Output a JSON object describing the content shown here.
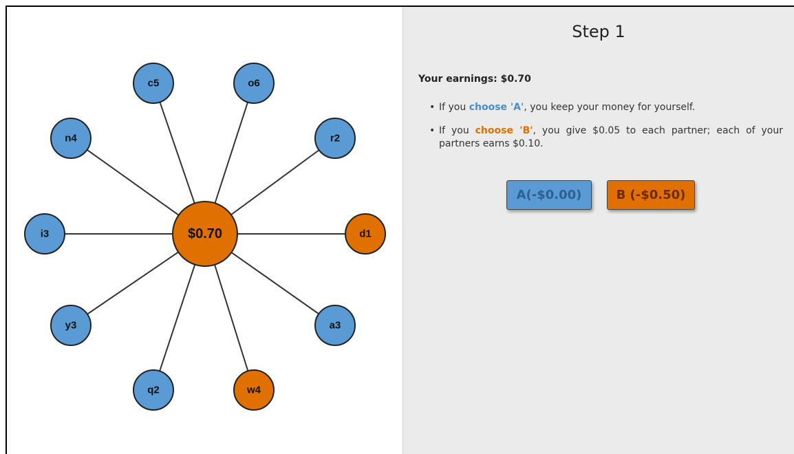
{
  "center": {
    "label": "$0.70",
    "color": "#e07000"
  },
  "neighbors": [
    {
      "label": "c5",
      "color": "#5b9bd5"
    },
    {
      "label": "o6",
      "color": "#5b9bd5"
    },
    {
      "label": "r2",
      "color": "#5b9bd5"
    },
    {
      "label": "d1",
      "color": "#e07000"
    },
    {
      "label": "a3",
      "color": "#5b9bd5"
    },
    {
      "label": "w4",
      "color": "#e07000"
    },
    {
      "label": "q2",
      "color": "#5b9bd5"
    },
    {
      "label": "y3",
      "color": "#5b9bd5"
    },
    {
      "label": "i3",
      "color": "#5b9bd5"
    },
    {
      "label": "n4",
      "color": "#5b9bd5"
    }
  ],
  "info": {
    "title": "Step 1",
    "earnings": "Your earnings: $0.70",
    "rule_a": {
      "prefix": "If you ",
      "highlight": "choose 'A'",
      "suffix": ", you keep your money for yourself."
    },
    "rule_b": {
      "prefix": "If you ",
      "highlight": "choose 'B'",
      "suffix": ", you give $0.05 to each partner; each of your partners earns $0.10."
    }
  },
  "buttons": {
    "a_label": "A(-$0.00)",
    "b_label": "B (-$0.50)"
  },
  "colors": {
    "blue": "#5b9bd5",
    "orange": "#e07000",
    "panel_bg": "#ebebeb"
  }
}
